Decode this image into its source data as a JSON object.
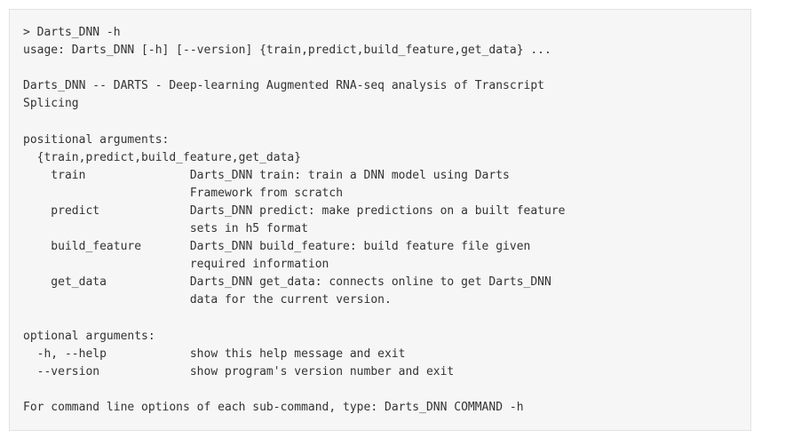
{
  "terminal": {
    "lines": [
      "> Darts_DNN -h",
      "usage: Darts_DNN [-h] [--version] {train,predict,build_feature,get_data} ...",
      "",
      "Darts_DNN -- DARTS - Deep-learning Augmented RNA-seq analysis of Transcript",
      "Splicing",
      "",
      "positional arguments:",
      "  {train,predict,build_feature,get_data}",
      "    train               Darts_DNN train: train a DNN model using Darts",
      "                        Framework from scratch",
      "    predict             Darts_DNN predict: make predictions on a built feature",
      "                        sets in h5 format",
      "    build_feature       Darts_DNN build_feature: build feature file given",
      "                        required information",
      "    get_data            Darts_DNN get_data: connects online to get Darts_DNN",
      "                        data for the current version.",
      "",
      "optional arguments:",
      "  -h, --help            show this help message and exit",
      "  --version             show program's version number and exit",
      "",
      "For command line options of each sub-command, type: Darts_DNN COMMAND -h"
    ]
  }
}
